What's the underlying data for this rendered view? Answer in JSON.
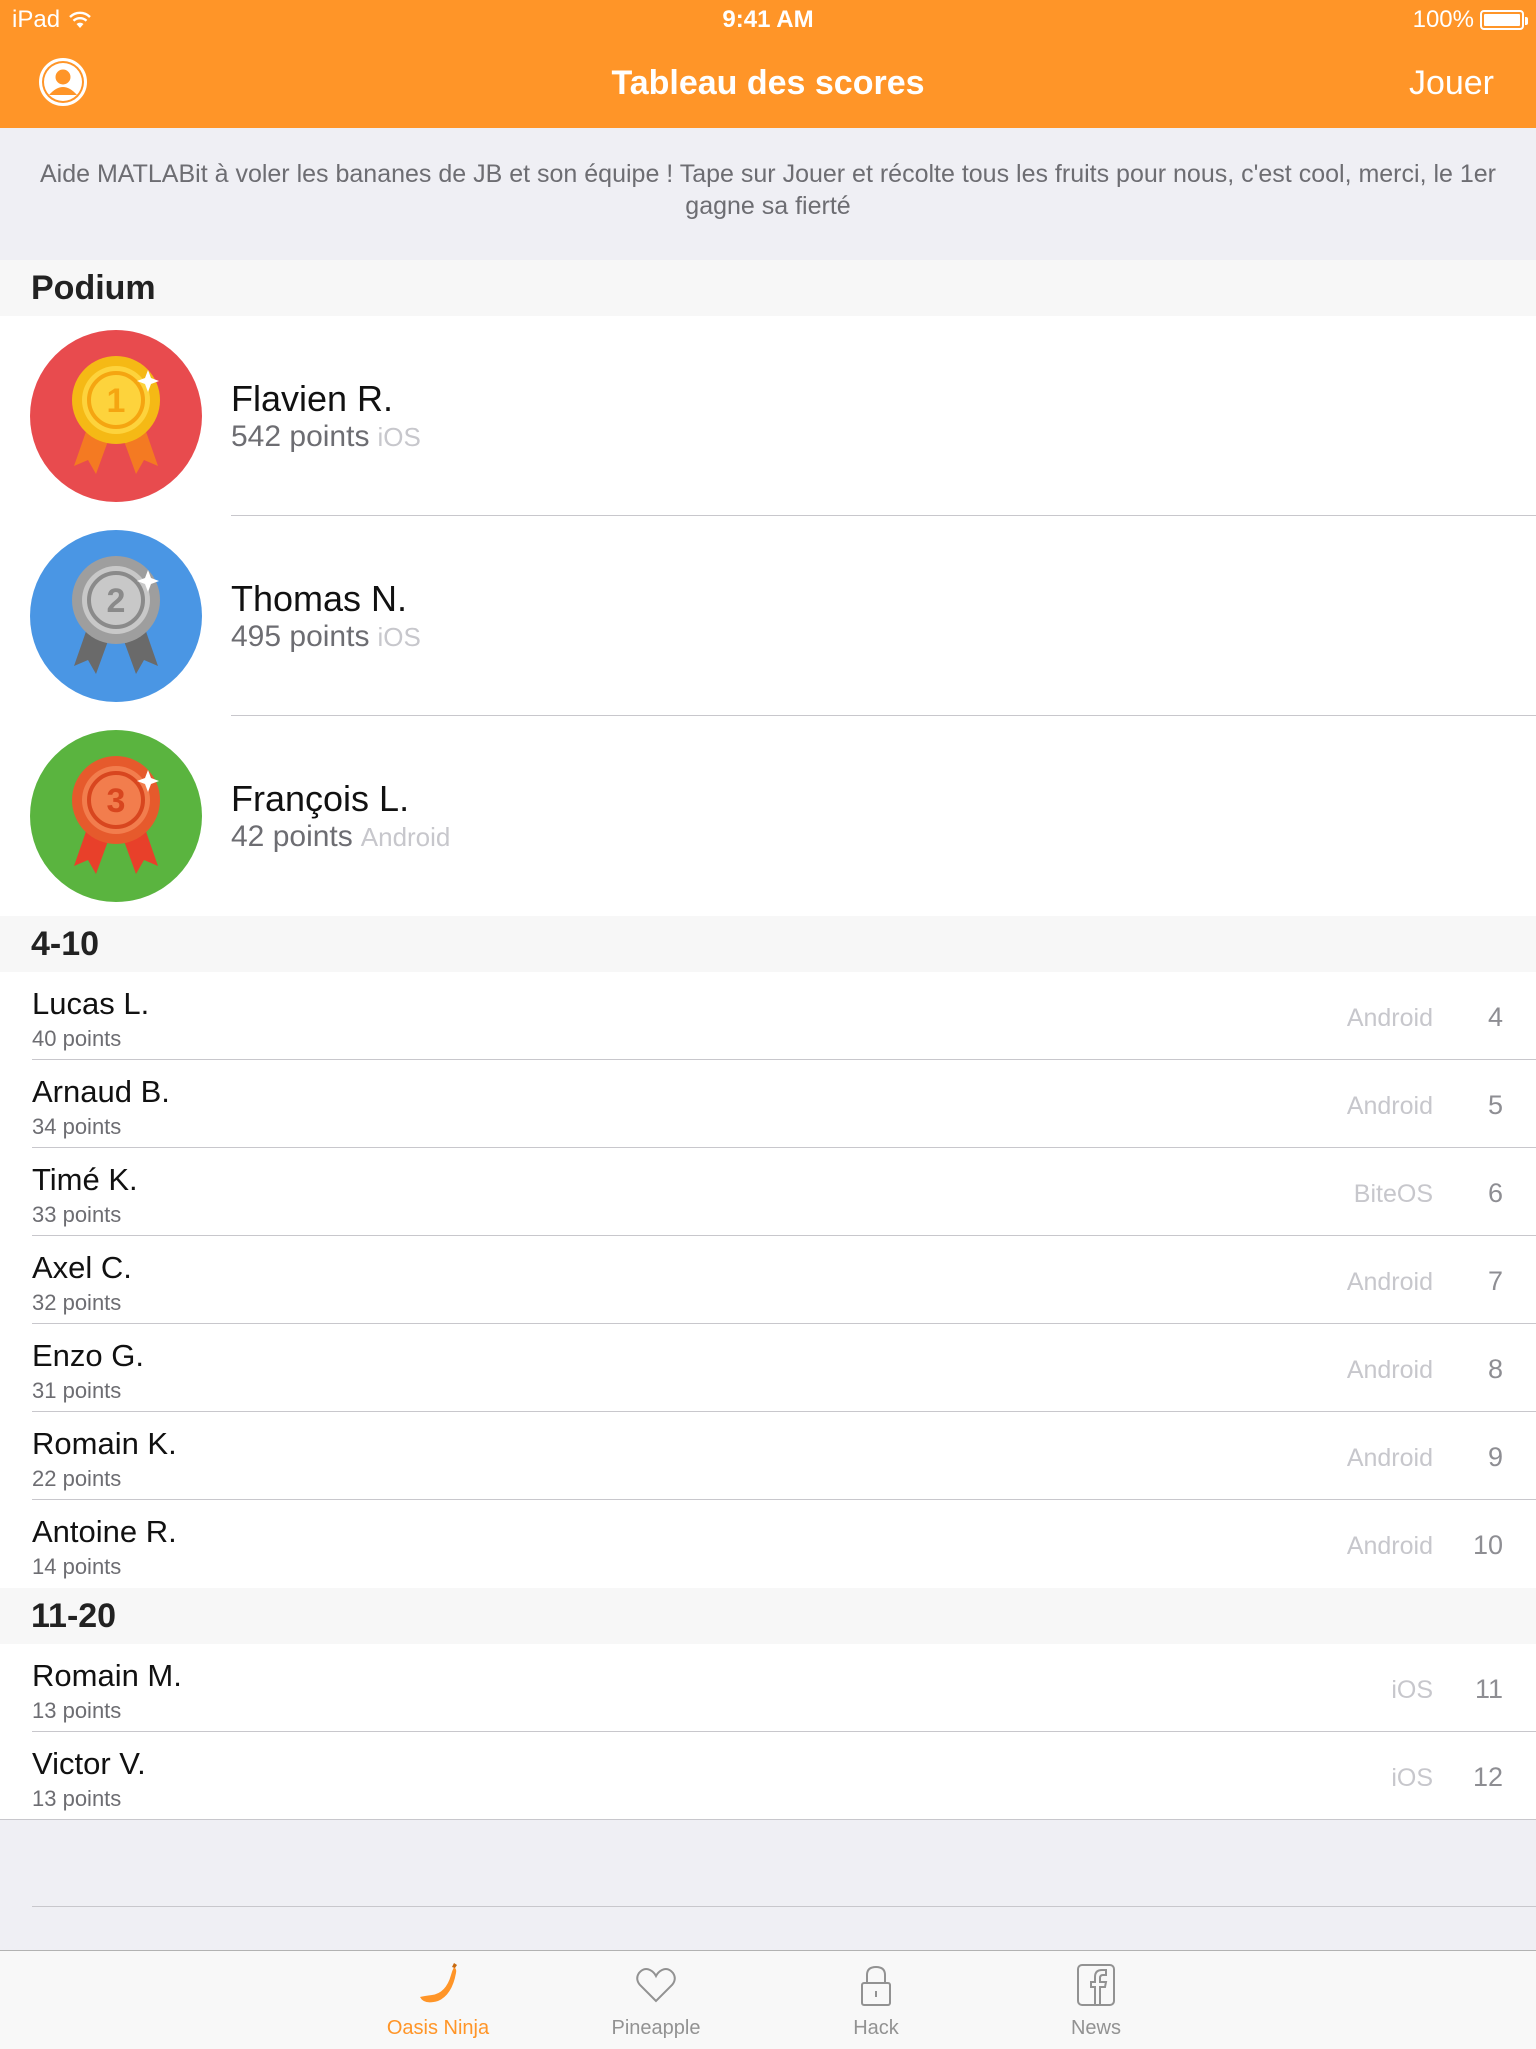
{
  "status_bar": {
    "device": "iPad",
    "time": "9:41 AM",
    "battery": "100%"
  },
  "nav": {
    "title": "Tableau des scores",
    "right_action": "Jouer",
    "left_icon": "profile-icon"
  },
  "intro": "Aide MATLABit à voler les bananes de JB et son équipe ! Tape sur Jouer et récolte tous les fruits pour nous, c'est cool, merci, le 1er gagne sa fierté",
  "sections": {
    "podium": {
      "title": "Podium",
      "rows": [
        {
          "medal": "1",
          "medal_colors": {
            "bg": "#e84b4e",
            "ring": "#f5b915",
            "inner": "#fdd33c",
            "ribbon": "#f47a22"
          },
          "name": "Flavien R.",
          "points": "542 points",
          "platform": "iOS"
        },
        {
          "medal": "2",
          "medal_colors": {
            "bg": "#4a96e4",
            "ring": "#9e9e9e",
            "inner": "#c8c8c8",
            "ribbon": "#6a6a6a"
          },
          "name": "Thomas N.",
          "points": "495 points",
          "platform": "iOS"
        },
        {
          "medal": "3",
          "medal_colors": {
            "bg": "#5ab43f",
            "ring": "#e65a2c",
            "inner": "#f27d4d",
            "ribbon": "#e8402a"
          },
          "name": "François L.",
          "points": "42 points",
          "platform": "Android"
        }
      ]
    },
    "s4_10": {
      "title": "4-10",
      "rows": [
        {
          "name": "Lucas L.",
          "points": "40 points",
          "platform": "Android",
          "rank": "4"
        },
        {
          "name": "Arnaud B.",
          "points": "34 points",
          "platform": "Android",
          "rank": "5"
        },
        {
          "name": "Timé K.",
          "points": "33 points",
          "platform": "BiteOS",
          "rank": "6"
        },
        {
          "name": "Axel C.",
          "points": "32 points",
          "platform": "Android",
          "rank": "7"
        },
        {
          "name": "Enzo G.",
          "points": "31 points",
          "platform": "Android",
          "rank": "8"
        },
        {
          "name": "Romain K.",
          "points": "22 points",
          "platform": "Android",
          "rank": "9"
        },
        {
          "name": "Antoine R.",
          "points": "14 points",
          "platform": "Android",
          "rank": "10"
        }
      ]
    },
    "s11_20": {
      "title": "11-20",
      "rows": [
        {
          "name": "Romain M.",
          "points": "13 points",
          "platform": "iOS",
          "rank": "11"
        },
        {
          "name": "Victor V.",
          "points": "13 points",
          "platform": "iOS",
          "rank": "12"
        }
      ]
    }
  },
  "tabs": [
    {
      "label": "Oasis Ninja",
      "icon": "banana-icon",
      "active": true
    },
    {
      "label": "Pineapple",
      "icon": "heart-icon",
      "active": false
    },
    {
      "label": "Hack",
      "icon": "lock-icon",
      "active": false
    },
    {
      "label": "News",
      "icon": "facebook-icon",
      "active": false
    }
  ],
  "colors": {
    "accent": "#ff9528",
    "background": "#efeff4",
    "secondary_text": "#6d6d72",
    "platform_text": "#c7c7cc"
  }
}
